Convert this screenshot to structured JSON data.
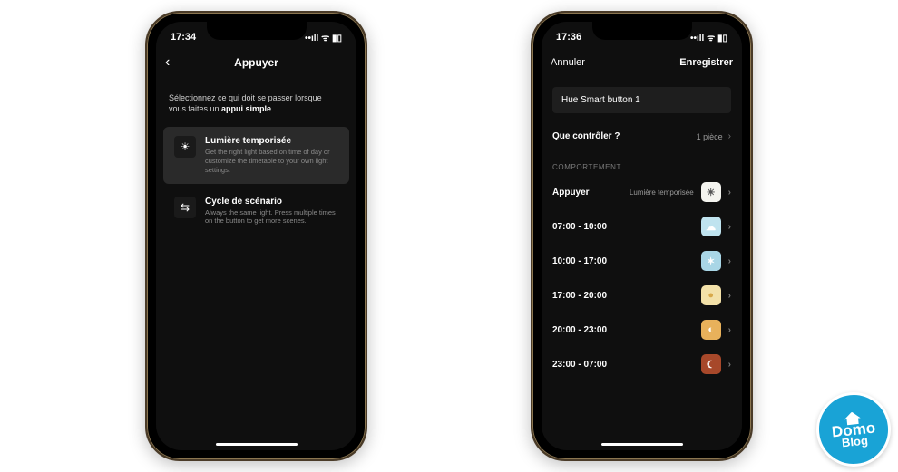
{
  "left_phone": {
    "status": {
      "time": "17:34",
      "indicators": "••ıll  ᯤ  ▮▯"
    },
    "header": {
      "title": "Appuyer"
    },
    "intro_line1": "Sélectionnez ce qui doit se passer lorsque",
    "intro_line2_prefix": "vous faites un ",
    "intro_line2_bold": "appui simple",
    "options": [
      {
        "icon": "sun-timed-icon",
        "glyph": "☀",
        "title": "Lumière temporisée",
        "desc": "Get the right light based on time of day or customize the timetable to your own light settings.",
        "selected": true
      },
      {
        "icon": "cycle-icon",
        "glyph": "⇆",
        "title": "Cycle de scénario",
        "desc": "Always the same light. Press multiple times on the button to get more scenes.",
        "selected": false
      }
    ]
  },
  "right_phone": {
    "status": {
      "time": "17:36",
      "indicators": "••ıll  ᯤ  ▮▯"
    },
    "header": {
      "cancel": "Annuler",
      "save": "Enregistrer"
    },
    "device_name": "Hue Smart button 1",
    "control": {
      "label": "Que contrôler ?",
      "value": "1 pièce"
    },
    "section_title": "COMPORTEMENT",
    "press_row": {
      "label": "Appuyer",
      "value": "Lumière temporisée",
      "icon_glyph": "☀"
    },
    "slots": [
      {
        "label": "07:00 - 10:00",
        "class": "si-sky",
        "glyph": "☁"
      },
      {
        "label": "10:00 - 17:00",
        "class": "si-blue",
        "glyph": "✶"
      },
      {
        "label": "17:00 - 20:00",
        "class": "si-warm",
        "glyph": "●"
      },
      {
        "label": "20:00 - 23:00",
        "class": "si-amber",
        "glyph": "◐"
      },
      {
        "label": "23:00 - 07:00",
        "class": "si-night",
        "glyph": "☾"
      }
    ]
  },
  "watermark": {
    "line1": "Domo",
    "line2": "Blog"
  }
}
